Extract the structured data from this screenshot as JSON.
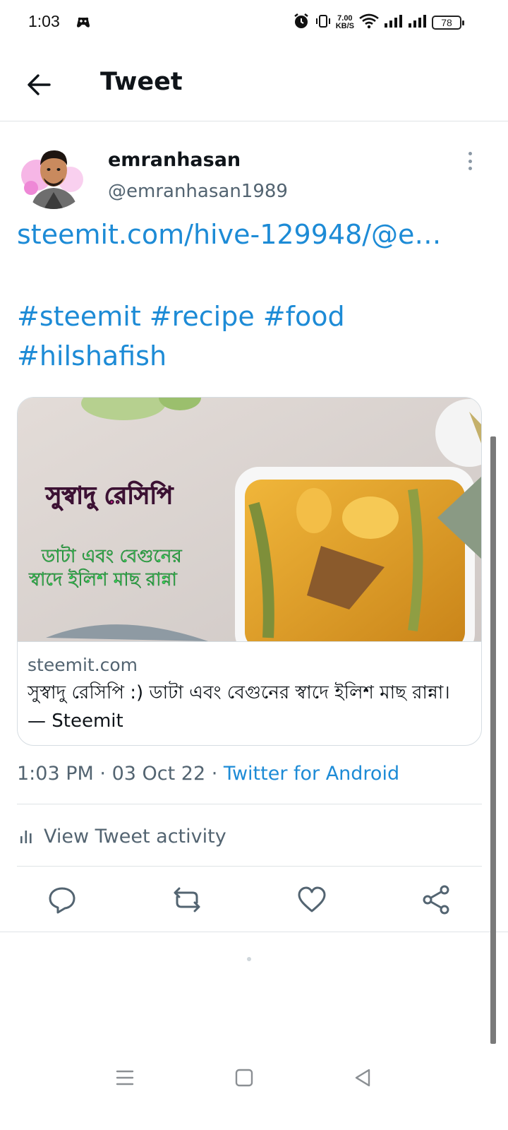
{
  "status_bar": {
    "time": "1:03",
    "net_speed_value": "7.00",
    "net_speed_unit": "KB/S",
    "battery": "78",
    "icons": [
      "game-icon",
      "alarm-icon",
      "vibrate-icon",
      "wifi-icon",
      "signal-icon",
      "signal-icon",
      "battery-icon"
    ]
  },
  "header": {
    "title": "Tweet",
    "back_icon": "arrow-left-icon"
  },
  "author": {
    "display_name": "emranhasan",
    "handle": "@emranhasan1989",
    "more_icon": "more-vertical-icon"
  },
  "tweet": {
    "link": "steemit.com/hive-129948/@e…",
    "hashtags": [
      "#steemit",
      "#recipe",
      "#food",
      "#hilshafish"
    ]
  },
  "card": {
    "image_text_line1": "সুস্বাদু রেসিপি",
    "image_text_line2": "ডাটা এবং বেগুনের",
    "image_text_line3": "স্বাদে ইলিশ মাছ রান্না",
    "domain": "steemit.com",
    "title": "সুস্বাদু রেসিপি :) ডাটা এবং বেগুনের স্বাদে ইলিশ মাছ রান্না। — Steemit"
  },
  "meta": {
    "time": "1:03 PM",
    "separator": "·",
    "date": "03 Oct 22",
    "source": "Twitter for Android"
  },
  "activity": {
    "label": "View Tweet activity",
    "icon": "analytics-icon"
  },
  "actions": [
    "reply-icon",
    "retweet-icon",
    "like-icon",
    "share-icon"
  ],
  "nav": [
    "menu-icon",
    "home-icon",
    "back-icon"
  ],
  "colors": {
    "link": "#1d8bd6",
    "secondary_text": "#536471",
    "primary_text": "#0f1419",
    "divider": "#dfe3e6"
  }
}
